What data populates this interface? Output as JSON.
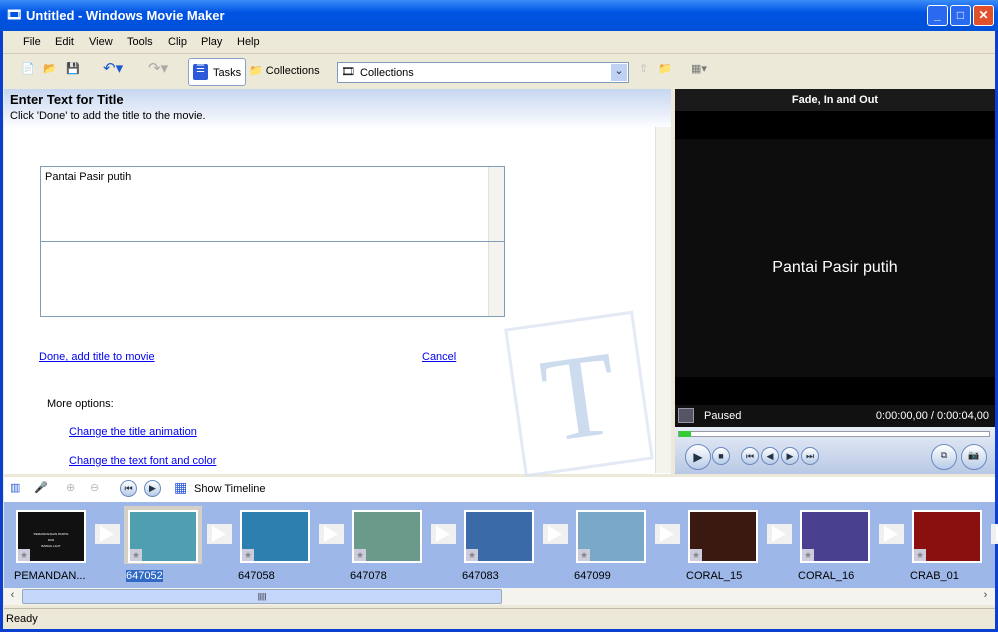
{
  "window": {
    "title": "Untitled - Windows Movie Maker"
  },
  "menu": [
    "File",
    "Edit",
    "View",
    "Tools",
    "Clip",
    "Play",
    "Help"
  ],
  "toolbar": {
    "tasks": "Tasks",
    "collections": "Collections",
    "combo_value": "Collections"
  },
  "panel": {
    "heading": "Enter Text for Title",
    "subheading": "Click 'Done' to add the title to the movie.",
    "title_text": "Pantai Pasir putih",
    "done_link": "Done, add title to movie",
    "cancel_link": "Cancel",
    "more_options": "More options:",
    "option_animation": "Change the title animation",
    "option_font": "Change the text font and color"
  },
  "preview": {
    "title": "Fade, In and Out",
    "display_text": "Pantai Pasir putih",
    "state": "Paused",
    "time": "0:00:00,00 / 0:00:04,00",
    "progress": 0
  },
  "storyboard": {
    "show_timeline": "Show Timeline",
    "clips": [
      {
        "name": "PEMANDAN...",
        "color": "#111111",
        "selected": false,
        "thumb_text": [
          "PEMANDANGAN PANTAI",
          "DAN",
          "BAWAH LAUT"
        ]
      },
      {
        "name": "647052",
        "color": "#4f9fb0",
        "selected": true
      },
      {
        "name": "647058",
        "color": "#2d7fb0",
        "selected": false
      },
      {
        "name": "647078",
        "color": "#6a9a8a",
        "selected": false
      },
      {
        "name": "647083",
        "color": "#3a6aa8",
        "selected": false
      },
      {
        "name": "647099",
        "color": "#7aa8c8",
        "selected": false
      },
      {
        "name": "CORAL_15",
        "color": "#3a1a10",
        "selected": false
      },
      {
        "name": "CORAL_16",
        "color": "#4a4090",
        "selected": false
      },
      {
        "name": "CRAB_01",
        "color": "#8a1010",
        "selected": false
      }
    ]
  },
  "status": {
    "text": "Ready"
  }
}
